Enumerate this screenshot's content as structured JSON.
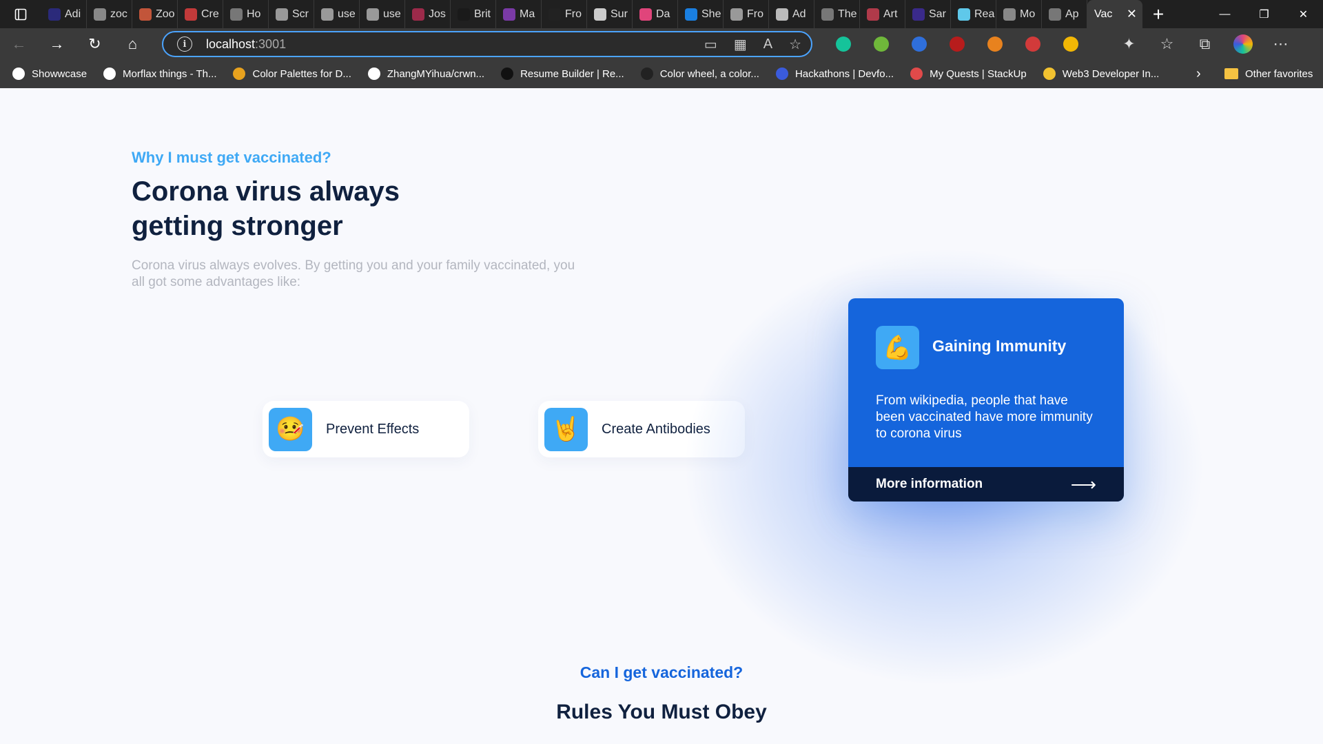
{
  "browser": {
    "tabs": [
      {
        "title": "Adi",
        "color": "#2b2a7a"
      },
      {
        "title": "zoc",
        "color": "#888888"
      },
      {
        "title": "Zoo",
        "color": "#c2553a"
      },
      {
        "title": "Cre",
        "color": "#c23a3a"
      },
      {
        "title": "Ho",
        "color": "#777777"
      },
      {
        "title": "Scr",
        "color": "#999999"
      },
      {
        "title": "use",
        "color": "#999999"
      },
      {
        "title": "use",
        "color": "#999999"
      },
      {
        "title": "Jos",
        "color": "#9c2a4a"
      },
      {
        "title": "Brit",
        "color": "#1a1a1a"
      },
      {
        "title": "Ma",
        "color": "#7a3aa6"
      },
      {
        "title": "Fro",
        "color": "#222222"
      },
      {
        "title": "Sur",
        "color": "#cccccc"
      },
      {
        "title": "Da",
        "color": "#e0457b"
      },
      {
        "title": "She",
        "color": "#1a7fe0"
      },
      {
        "title": "Fro",
        "color": "#999999"
      },
      {
        "title": "Ad",
        "color": "#bbbbbb"
      },
      {
        "title": "The",
        "color": "#777777"
      },
      {
        "title": "Art",
        "color": "#b03a4a"
      },
      {
        "title": "Sar",
        "color": "#3a2a8a"
      },
      {
        "title": "Rea",
        "color": "#5fc8ea"
      },
      {
        "title": "Mo",
        "color": "#888888"
      },
      {
        "title": "Ap",
        "color": "#777777"
      }
    ],
    "active_tab": {
      "title": "Vac",
      "close": "✕"
    },
    "new_tab": "+",
    "window_controls": {
      "minimize": "—",
      "restore": "❐",
      "close": "✕"
    },
    "address": {
      "host": "localhost",
      "port": ":3001"
    },
    "extensions": [
      {
        "name": "grammarly",
        "color": "#15c39a"
      },
      {
        "name": "download",
        "color": "#6fb83a"
      },
      {
        "name": "todo",
        "color": "#2f6fdb"
      },
      {
        "name": "ublock",
        "color": "#b71c1c"
      },
      {
        "name": "metamask",
        "color": "#e8821e"
      },
      {
        "name": "extension-red",
        "color": "#d23a3a"
      },
      {
        "name": "chrome-like",
        "color": "#f2b705"
      }
    ],
    "bookmarks": [
      {
        "label": "Showwcase",
        "color": "#ffffff"
      },
      {
        "label": "Morflax things - Th...",
        "color": "#ffffff"
      },
      {
        "label": "Color Palettes for D...",
        "color": "#e8a21e"
      },
      {
        "label": "ZhangMYihua/crwn...",
        "color": "#ffffff"
      },
      {
        "label": "Resume Builder | Re...",
        "color": "#111111"
      },
      {
        "label": "Color wheel, a color...",
        "color": "#222222"
      },
      {
        "label": "Hackathons | Devfo...",
        "color": "#3a5bdc"
      },
      {
        "label": "My Quests | StackUp",
        "color": "#e04a4a"
      },
      {
        "label": "Web3 Developer In...",
        "color": "#f2c230"
      }
    ],
    "other_favorites": "Other favorites",
    "bookmarks_more": "›"
  },
  "hero": {
    "eyebrow": "Why I must get vaccinated?",
    "title": "Corona virus always getting stronger",
    "description": "Corona virus always evolves. By getting you and your family vaccinated, you all got some advantages like:"
  },
  "advantages": [
    {
      "emoji": "🤒",
      "label": "Prevent Effects"
    },
    {
      "emoji": "🤘",
      "label": "Create Antibodies"
    }
  ],
  "feature": {
    "emoji": "💪",
    "title": "Gaining Immunity",
    "description": "From wikipedia, people that have been vaccinated have more immunity to corona virus",
    "link_label": "More information",
    "arrow": "⟶"
  },
  "rules": {
    "eyebrow": "Can I get vaccinated?",
    "title": "Rules You Must Obey"
  },
  "colors": {
    "accent_light": "#3fa9f5",
    "accent": "#1565dc",
    "navy": "#10213f",
    "footer_navy": "#0a1b3c"
  }
}
